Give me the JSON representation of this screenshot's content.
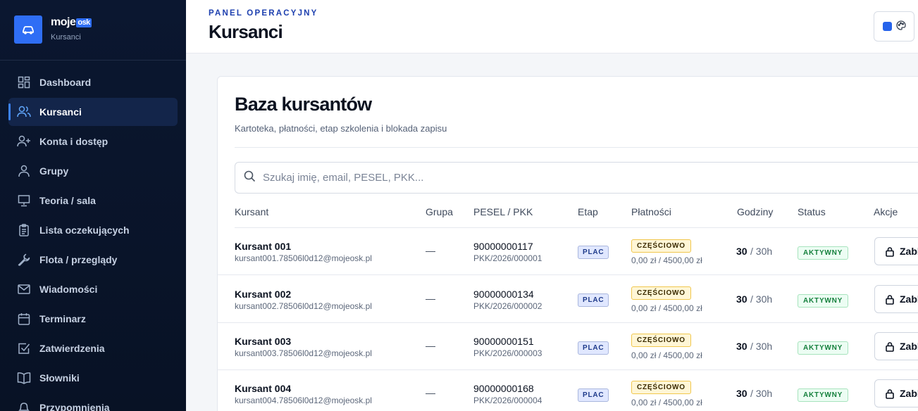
{
  "brand": {
    "name": "moje",
    "pill": "osk",
    "subtitle": "Kursanci"
  },
  "sidebar": {
    "items": [
      {
        "label": "Dashboard",
        "icon": "grid-icon"
      },
      {
        "label": "Kursanci",
        "icon": "users-icon",
        "active": true
      },
      {
        "label": "Konta i dostęp",
        "icon": "user-plus-icon"
      },
      {
        "label": "Grupy",
        "icon": "user-icon"
      },
      {
        "label": "Teoria / sala",
        "icon": "presentation-icon"
      },
      {
        "label": "Lista oczekujących",
        "icon": "clipboard-icon"
      },
      {
        "label": "Flota / przeglądy",
        "icon": "wrench-icon"
      },
      {
        "label": "Wiadomości",
        "icon": "mail-icon"
      },
      {
        "label": "Terminarz",
        "icon": "calendar-icon"
      },
      {
        "label": "Zatwierdzenia",
        "icon": "check-square-icon"
      },
      {
        "label": "Słowniki",
        "icon": "book-icon"
      },
      {
        "label": "Przypomnienia",
        "icon": "bell-icon"
      }
    ]
  },
  "header": {
    "eyebrow": "PANEL OPERACYJNY",
    "title": "Kursanci"
  },
  "card": {
    "title": "Baza kursantów",
    "subtitle": "Kartoteka, płatności, etap szkolenia i blokada zapisu"
  },
  "search": {
    "placeholder": "Szukaj imię, email, PESEL, PKK..."
  },
  "table": {
    "headers": [
      "Kursant",
      "Grupa",
      "PESEL / PKK",
      "Etap",
      "Płatności",
      "Godziny",
      "Status",
      "Akcje"
    ],
    "rows": [
      {
        "name": "Kursant 001",
        "email": "kursant001.78506l0d12@mojeosk.pl",
        "group": "—",
        "pesel": "90000000117",
        "pkk": "PKK/2026/000001",
        "stage": "PLAC",
        "payment_status": "CZĘŚCIOWO",
        "payment": "0,00 zł / 4500,00 zł",
        "hours": "30",
        "hours_total": "/ 30h",
        "status": "AKTYWNY",
        "action": "Zablokuj"
      },
      {
        "name": "Kursant 002",
        "email": "kursant002.78506l0d12@mojeosk.pl",
        "group": "—",
        "pesel": "90000000134",
        "pkk": "PKK/2026/000002",
        "stage": "PLAC",
        "payment_status": "CZĘŚCIOWO",
        "payment": "0,00 zł / 4500,00 zł",
        "hours": "30",
        "hours_total": "/ 30h",
        "status": "AKTYWNY",
        "action": "Zablokuj"
      },
      {
        "name": "Kursant 003",
        "email": "kursant003.78506l0d12@mojeosk.pl",
        "group": "—",
        "pesel": "90000000151",
        "pkk": "PKK/2026/000003",
        "stage": "PLAC",
        "payment_status": "CZĘŚCIOWO",
        "payment": "0,00 zł / 4500,00 zł",
        "hours": "30",
        "hours_total": "/ 30h",
        "status": "AKTYWNY",
        "action": "Zablokuj"
      },
      {
        "name": "Kursant 004",
        "email": "kursant004.78506l0d12@mojeosk.pl",
        "group": "—",
        "pesel": "90000000168",
        "pkk": "PKK/2026/000004",
        "stage": "PLAC",
        "payment_status": "CZĘŚCIOWO",
        "payment": "0,00 zł / 4500,00 zł",
        "hours": "30",
        "hours_total": "/ 30h",
        "status": "AKTYWNY",
        "action": "Zablokuj"
      }
    ]
  },
  "colors": {
    "accent": "#2f6ef5",
    "sidebar": "#0b1730",
    "success": "#15803d",
    "warning": "#f0c74e"
  }
}
